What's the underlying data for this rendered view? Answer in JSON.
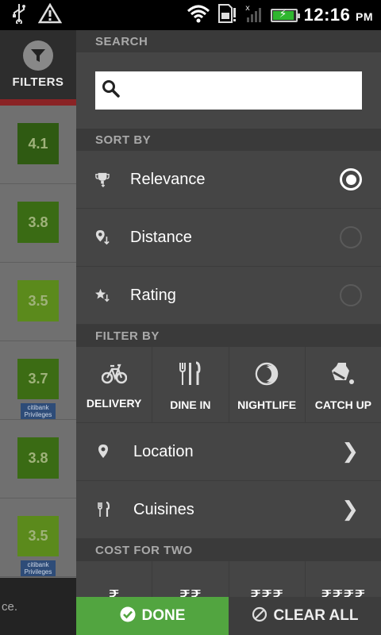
{
  "status_bar": {
    "time": "12:16",
    "ampm": "PM",
    "icons": [
      "usb-icon",
      "warning-icon",
      "wifi-icon",
      "sd-card-icon",
      "signal-icon",
      "battery-charging-icon"
    ]
  },
  "sidebar": {
    "filters_label": "FILTERS",
    "ratings": [
      {
        "value": "4.1",
        "color": "#2f5a12",
        "citi": false
      },
      {
        "value": "3.8",
        "color": "#3a6b14",
        "citi": false
      },
      {
        "value": "3.5",
        "color": "#5b8a1c",
        "citi": false
      },
      {
        "value": "3.7",
        "color": "#3c6c14",
        "citi": true
      },
      {
        "value": "3.8",
        "color": "#3a6b14",
        "citi": false
      },
      {
        "value": "3.5",
        "color": "#5b8a1c",
        "citi": true
      }
    ],
    "citi_line1": "citibank",
    "citi_line2": "Privileges",
    "bottom_text": "ce."
  },
  "search": {
    "header": "SEARCH",
    "value": "",
    "placeholder": ""
  },
  "sort": {
    "header": "SORT BY",
    "options": [
      {
        "label": "Relevance",
        "icon": "trophy-icon",
        "selected": true
      },
      {
        "label": "Distance",
        "icon": "location-sort-icon",
        "selected": false
      },
      {
        "label": "Rating",
        "icon": "star-sort-icon",
        "selected": false
      }
    ]
  },
  "filter": {
    "header": "FILTER BY",
    "types": [
      {
        "label": "DELIVERY",
        "icon": "bicycle-icon"
      },
      {
        "label": "DINE IN",
        "icon": "cutlery-icon"
      },
      {
        "label": "NIGHTLIFE",
        "icon": "moon-icon"
      },
      {
        "label": "CATCH UP",
        "icon": "cup-icon"
      }
    ],
    "location_label": "Location",
    "cuisines_label": "Cuisines"
  },
  "cost": {
    "header": "COST FOR TWO",
    "options": [
      "₹",
      "₹₹",
      "₹₹₹",
      "₹₹₹₹"
    ]
  },
  "buttons": {
    "done": "DONE",
    "clear_all": "CLEAR ALL"
  },
  "colors": {
    "done_green": "#52a540",
    "accent_red": "#8a2325"
  }
}
